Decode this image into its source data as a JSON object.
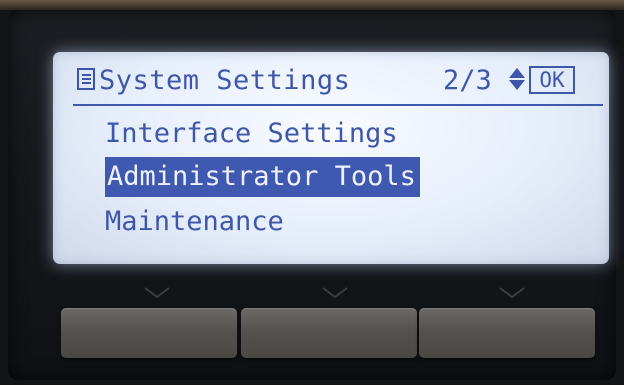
{
  "header": {
    "title": "System Settings",
    "page_indicator": "2/3",
    "ok_label": "OK",
    "icons": [
      "menu-icon",
      "up-down-arrows-icon"
    ]
  },
  "menu": {
    "items": [
      {
        "label": "Interface Settings",
        "selected": false
      },
      {
        "label": "Administrator Tools",
        "selected": true
      },
      {
        "label": "Maintenance",
        "selected": false
      }
    ]
  },
  "colors": {
    "lcd_text": "#3f57a9",
    "lcd_highlight": "#3f58b0",
    "lcd_background": "#e6eefb",
    "bezel": "#121416"
  }
}
